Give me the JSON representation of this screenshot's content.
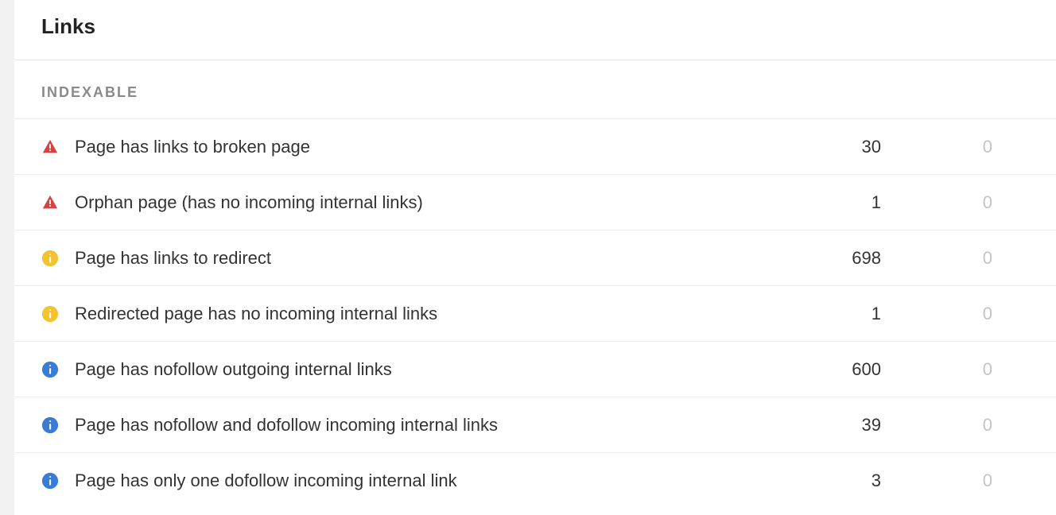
{
  "panel": {
    "title": "Links",
    "section_label": "Indexable"
  },
  "rows": [
    {
      "severity": "error",
      "label": "Page has links to broken page",
      "count": "30",
      "delta": "0"
    },
    {
      "severity": "error",
      "label": "Orphan page (has no incoming internal links)",
      "count": "1",
      "delta": "0"
    },
    {
      "severity": "warning",
      "label": "Page has links to redirect",
      "count": "698",
      "delta": "0"
    },
    {
      "severity": "warning",
      "label": "Redirected page has no incoming internal links",
      "count": "1",
      "delta": "0"
    },
    {
      "severity": "info",
      "label": "Page has nofollow outgoing internal links",
      "count": "600",
      "delta": "0"
    },
    {
      "severity": "info",
      "label": "Page has nofollow and dofollow incoming internal links",
      "count": "39",
      "delta": "0"
    },
    {
      "severity": "info",
      "label": "Page has only one dofollow incoming internal link",
      "count": "3",
      "delta": "0"
    }
  ]
}
